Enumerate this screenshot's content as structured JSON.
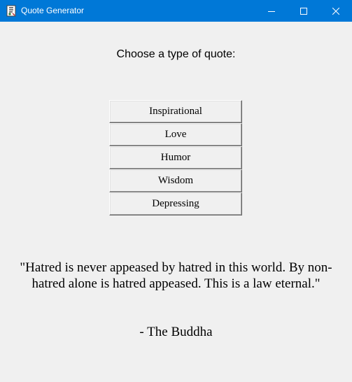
{
  "window": {
    "title": "Quote Generator",
    "app_icon": "feather-pen-icon",
    "controls": [
      "minimize-icon",
      "maximize-icon",
      "close-icon"
    ],
    "titlebar_color": "#0078d7"
  },
  "main": {
    "prompt": "Choose a type of quote:",
    "buttons": [
      {
        "label": "Inspirational"
      },
      {
        "label": "Love"
      },
      {
        "label": "Humor"
      },
      {
        "label": "Wisdom"
      },
      {
        "label": "Depressing"
      }
    ],
    "quote_text": "\"Hatred is never appeased by hatred in this world. By non-hatred alone is hatred appeased. This is a law eternal.\"",
    "quote_author": "- The Buddha"
  }
}
